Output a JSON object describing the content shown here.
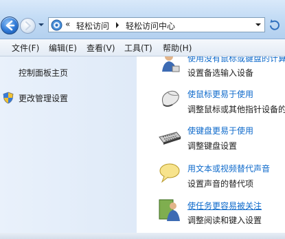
{
  "nav": {
    "back_label": "",
    "breadcrumb_prefix": "«",
    "crumbs": [
      "轻松访问",
      "轻松访问中心"
    ]
  },
  "menu": {
    "items": [
      "文件(F)",
      "编辑(E)",
      "查看(V)",
      "工具(T)",
      "帮助(H)"
    ]
  },
  "left_pane": {
    "home_link": "控制面板主页",
    "admin_link": "更改管理设置"
  },
  "tasks": [
    {
      "title": "使用没有鼠标或键盘的计算机",
      "desc": "设置备选输入设备",
      "icon": "person-icon"
    },
    {
      "title": "使鼠标更易于使用",
      "desc": "调整鼠标或其他指针设备的工作方式",
      "icon": "mouse-icon"
    },
    {
      "title": "使键盘更易于使用",
      "desc": "调整键盘设置",
      "icon": "keyboard-icon"
    },
    {
      "title": "用文本或视频替代声音",
      "desc": "设置声音的替代项",
      "icon": "speech-bubble-icon"
    },
    {
      "title": "使任务更容易被关注",
      "desc": "调整阅读和键入设置",
      "icon": "focus-person-icon"
    }
  ],
  "colors": {
    "link": "#0e6acb",
    "nav_pane": "#e4edf9",
    "toolbar": "#c4dcf5"
  }
}
